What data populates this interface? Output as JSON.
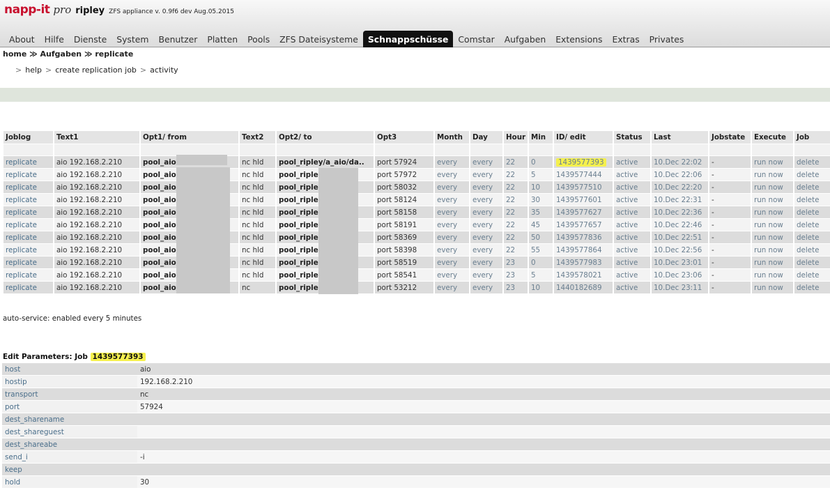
{
  "header": {
    "logo_napp": "napp-it",
    "logo_pro": "pro",
    "hostname": "ripley",
    "version": "ZFS appliance v. 0.9f6 dev Aug.05.2015"
  },
  "menu": [
    {
      "label": "About",
      "active": false
    },
    {
      "label": "Hilfe",
      "active": false
    },
    {
      "label": "Dienste",
      "active": false
    },
    {
      "label": "System",
      "active": false
    },
    {
      "label": "Benutzer",
      "active": false
    },
    {
      "label": "Platten",
      "active": false
    },
    {
      "label": "Pools",
      "active": false
    },
    {
      "label": "ZFS Dateisysteme",
      "active": false
    },
    {
      "label": "Schnappschüsse",
      "active": true
    },
    {
      "label": "Comstar",
      "active": false
    },
    {
      "label": "Aufgaben",
      "active": false
    },
    {
      "label": "Extensions",
      "active": false
    },
    {
      "label": "Extras",
      "active": false
    },
    {
      "label": "Privates",
      "active": false
    }
  ],
  "breadcrumb": {
    "home": "home",
    "aufgaben": "Aufgaben",
    "replicate": "replicate",
    "sep": "≫"
  },
  "submenu": {
    "help": "help",
    "create": "create replication job",
    "activity": "activity",
    "sep": ">"
  },
  "jobs_table": {
    "headers": [
      "Joblog",
      "Text1",
      "Opt1/ from",
      "Text2",
      "Opt2/ to",
      "Opt3",
      "Month",
      "Day",
      "Hour",
      "Min",
      "ID/ edit",
      "Status",
      "Last",
      "Jobstate",
      "Execute",
      "Job"
    ],
    "rows": [
      [
        "replicate",
        "aio 192.168.2.210",
        "pool_aio/",
        "nc hld",
        "pool_ripley/a_aio/da..",
        "port 57924",
        "every",
        "every",
        "22",
        "0",
        "1439577393",
        "active",
        "10.Dec 22:02",
        "-",
        "run now",
        "delete"
      ],
      [
        "replicate",
        "aio 192.168.2.210",
        "pool_aio/",
        "nc hld",
        "pool_ripley",
        "port 57972",
        "every",
        "every",
        "22",
        "5",
        "1439577444",
        "active",
        "10.Dec 22:06",
        "-",
        "run now",
        "delete"
      ],
      [
        "replicate",
        "aio 192.168.2.210",
        "pool_aio/",
        "nc hld",
        "pool_ripley",
        "port 58032",
        "every",
        "every",
        "22",
        "10",
        "1439577510",
        "active",
        "10.Dec 22:20",
        "-",
        "run now",
        "delete"
      ],
      [
        "replicate",
        "aio 192.168.2.210",
        "pool_aio/",
        "nc hld",
        "pool_ripley",
        "port 58124",
        "every",
        "every",
        "22",
        "30",
        "1439577601",
        "active",
        "10.Dec 22:31",
        "-",
        "run now",
        "delete"
      ],
      [
        "replicate",
        "aio 192.168.2.210",
        "pool_aio/",
        "nc hld",
        "pool_ripley",
        "port 58158",
        "every",
        "every",
        "22",
        "35",
        "1439577627",
        "active",
        "10.Dec 22:36",
        "-",
        "run now",
        "delete"
      ],
      [
        "replicate",
        "aio 192.168.2.210",
        "pool_aio/",
        "nc hld",
        "pool_ripley",
        "port 58191",
        "every",
        "every",
        "22",
        "45",
        "1439577657",
        "active",
        "10.Dec 22:46",
        "-",
        "run now",
        "delete"
      ],
      [
        "replicate",
        "aio 192.168.2.210",
        "pool_aio/",
        "nc hld",
        "pool_ripley",
        "port 58369",
        "every",
        "every",
        "22",
        "50",
        "1439577836",
        "active",
        "10.Dec 22:51",
        "-",
        "run now",
        "delete"
      ],
      [
        "replicate",
        "aio 192.168.2.210",
        "pool_aio/",
        "nc hld",
        "pool_ripley",
        "port 58398",
        "every",
        "every",
        "22",
        "55",
        "1439577864",
        "active",
        "10.Dec 22:56",
        "-",
        "run now",
        "delete"
      ],
      [
        "replicate",
        "aio 192.168.2.210",
        "pool_aio/",
        "nc hld",
        "pool_ripley",
        "port 58519",
        "every",
        "every",
        "23",
        "0",
        "1439577983",
        "active",
        "10.Dec 23:01",
        "-",
        "run now",
        "delete"
      ],
      [
        "replicate",
        "aio 192.168.2.210",
        "pool_aio/",
        "nc hld",
        "pool_ripley",
        "port 58541",
        "every",
        "every",
        "23",
        "5",
        "1439578021",
        "active",
        "10.Dec 23:06",
        "-",
        "run now",
        "delete"
      ],
      [
        "replicate",
        "aio 192.168.2.210",
        "pool_aio/",
        "nc",
        "pool_ripley",
        "port 53212",
        "every",
        "every",
        "23",
        "10",
        "1440182689",
        "active",
        "10.Dec 23:11",
        "-",
        "run now",
        "delete"
      ]
    ],
    "highlight_color": "#f5f04d"
  },
  "autoservice": "auto-service: enabled every 5 minutes",
  "edit": {
    "title_prefix": "Edit Parameters: Job",
    "job_id": "1439577393",
    "params": [
      {
        "key": "host",
        "value": "aio"
      },
      {
        "key": "hostip",
        "value": "192.168.2.210"
      },
      {
        "key": "transport",
        "value": "nc"
      },
      {
        "key": "port",
        "value": "57924"
      },
      {
        "key": "dest_sharename",
        "value": ""
      },
      {
        "key": "dest_shareguest",
        "value": ""
      },
      {
        "key": "dest_shareabe",
        "value": ""
      },
      {
        "key": "send_i",
        "value": "-i"
      },
      {
        "key": "keep",
        "value": ""
      },
      {
        "key": "hold",
        "value": "30"
      }
    ]
  }
}
